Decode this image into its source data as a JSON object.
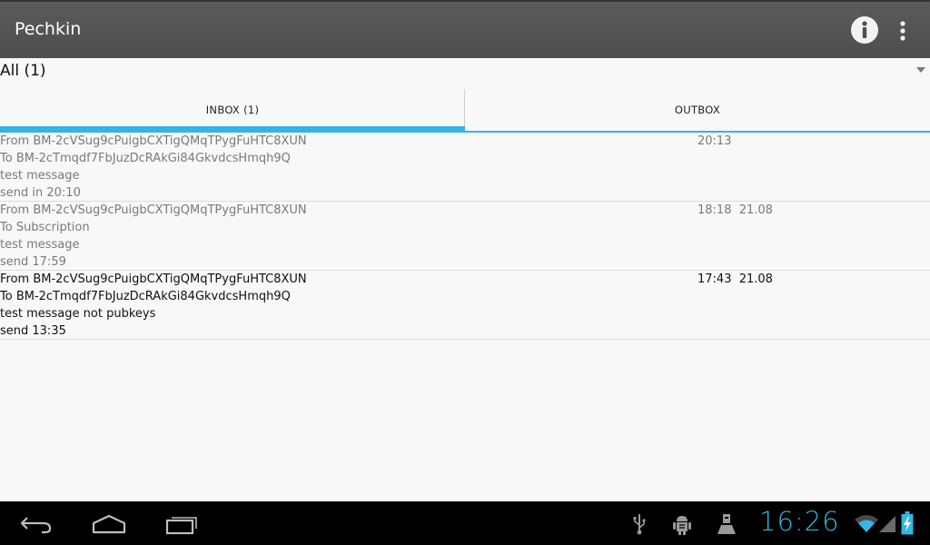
{
  "app": {
    "title": "Pechkin"
  },
  "filter": {
    "selected": "All (1)"
  },
  "tabs": [
    {
      "label": "INBOX (1)",
      "selected": true
    },
    {
      "label": "OUTBOX",
      "selected": false
    }
  ],
  "messages": [
    {
      "from": "From BM-2cVSug9cPuigbCXTigQMqTPygFuHTC8XUN",
      "to": "To BM-2cTmqdf7FbJuzDcRAkGi84GkvdcsHmqh9Q",
      "subject": "test message",
      "status": "send in 20:10",
      "time": "20:13",
      "read": true
    },
    {
      "from": "From BM-2cVSug9cPuigbCXTigQMqTPygFuHTC8XUN",
      "to": "To Subscription",
      "subject": "test message",
      "status": "send 17:59",
      "time": "18:18  21.08",
      "read": true
    },
    {
      "from": "From BM-2cVSug9cPuigbCXTigQMqTPygFuHTC8XUN",
      "to": "To BM-2cTmqdf7FbJuzDcRAkGi84GkvdcsHmqh9Q",
      "subject": "test message not pubkeys",
      "status": "send 13:35",
      "time": "17:43  21.08",
      "read": false
    }
  ],
  "system_bar": {
    "clock": "16:26",
    "accent_color": "#33b5e5"
  },
  "icons": {
    "info": "info-icon",
    "overflow": "overflow-menu-icon",
    "spinner": "dropdown-arrow-icon",
    "back": "back-icon",
    "home": "home-icon",
    "recent": "recent-apps-icon",
    "usb": "usb-icon",
    "android_debug": "android-debug-icon",
    "notification": "notification-icon",
    "wifi": "wifi-icon",
    "signal": "signal-icon",
    "battery": "battery-charging-icon"
  }
}
